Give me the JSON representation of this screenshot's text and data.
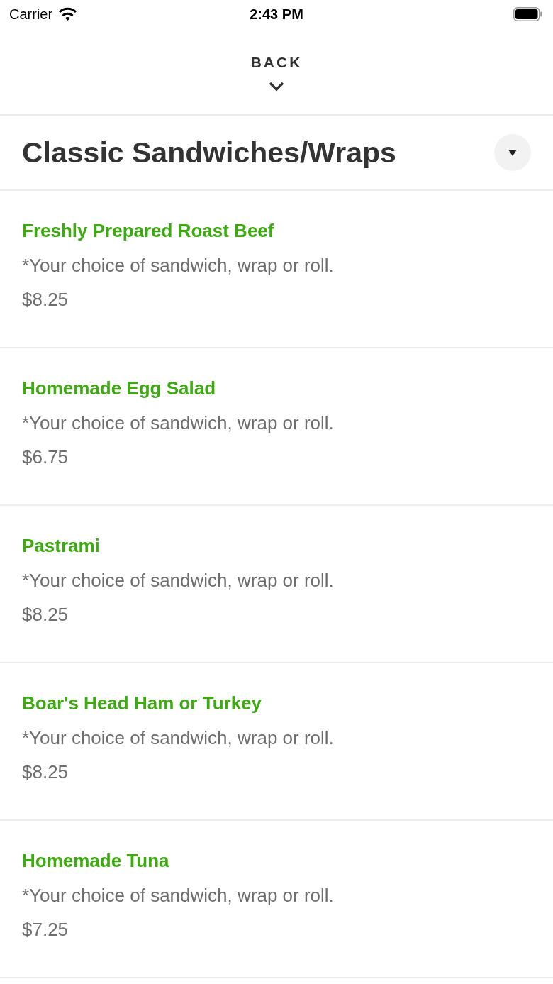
{
  "status_bar": {
    "carrier": "Carrier",
    "time": "2:43 PM"
  },
  "navigation": {
    "back_label": "BACK"
  },
  "section": {
    "title": "Classic Sandwiches/Wraps"
  },
  "items": [
    {
      "name": "Freshly Prepared Roast Beef",
      "description": "*Your choice of sandwich, wrap or roll.",
      "price": "$8.25"
    },
    {
      "name": "Homemade Egg Salad",
      "description": "*Your choice of sandwich, wrap or roll.",
      "price": "$6.75"
    },
    {
      "name": "Pastrami",
      "description": "*Your choice of sandwich, wrap or roll.",
      "price": "$8.25"
    },
    {
      "name": "Boar's Head Ham or Turkey",
      "description": "*Your choice of sandwich, wrap or roll.",
      "price": "$8.25"
    },
    {
      "name": "Homemade Tuna",
      "description": "*Your choice of sandwich, wrap or roll.",
      "price": "$7.25"
    }
  ]
}
